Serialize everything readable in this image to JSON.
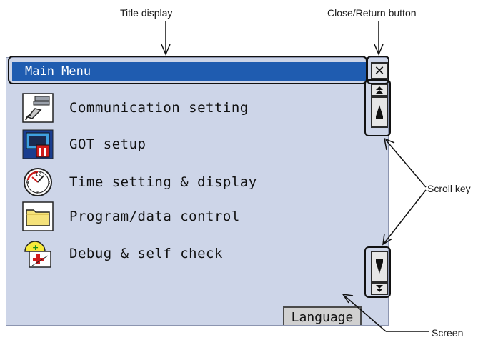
{
  "callouts": {
    "title_display": "Title display",
    "close_return": "Close/Return button",
    "scroll_key": "Scroll key",
    "screen": "Screen"
  },
  "window": {
    "title": "Main Menu",
    "close_symbol": "✕"
  },
  "menu": {
    "items": [
      {
        "label": "Communication setting",
        "icon": "communication-icon"
      },
      {
        "label": "GOT setup",
        "icon": "got-setup-icon"
      },
      {
        "label": "Time setting & display",
        "icon": "clock-icon"
      },
      {
        "label": "Program/data control",
        "icon": "folder-icon"
      },
      {
        "label": "Debug & self check",
        "icon": "debug-icon"
      }
    ]
  },
  "scroll": {
    "top_symbol": "⏫",
    "page_up_symbol": "▲",
    "page_down_symbol": "▼",
    "bottom_symbol": "⏬"
  },
  "footer": {
    "language_label": "Language"
  },
  "colors": {
    "title_bar": "#1f5cb0",
    "screen_bg": "#cdd5e8",
    "button_bg": "#e6e6e6"
  }
}
